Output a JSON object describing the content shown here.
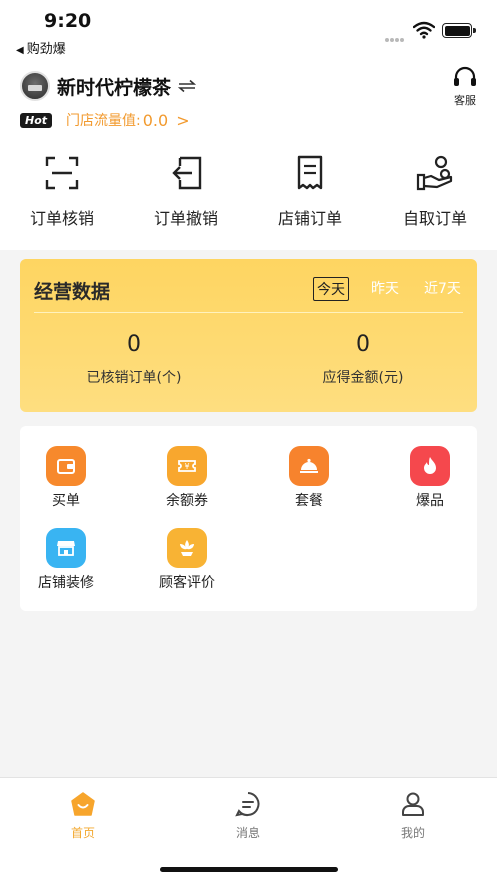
{
  "status_bar": {
    "time": "9:20",
    "back_app": "购劲爆"
  },
  "header": {
    "store_name": "新时代柠檬茶",
    "service_label": "客服",
    "hot_badge": "Hot",
    "traffic_label": "门店流量值:",
    "traffic_value": "0.0",
    "traffic_arrow": ">"
  },
  "quick_actions": [
    {
      "label": "订单核销",
      "icon": "scan-icon"
    },
    {
      "label": "订单撤销",
      "icon": "return-icon"
    },
    {
      "label": "店铺订单",
      "icon": "receipt-icon"
    },
    {
      "label": "自取订单",
      "icon": "hand-pickup-icon"
    }
  ],
  "business": {
    "title": "经营数据",
    "periods": [
      "今天",
      "昨天",
      "近7天"
    ],
    "selected_period": "今天",
    "stats": [
      {
        "value": "0",
        "label": "已核销订单(个)"
      },
      {
        "value": "0",
        "label": "应得金额(元)"
      }
    ]
  },
  "functions": [
    {
      "label": "买单",
      "icon": "wallet-icon",
      "color": "#f7892c"
    },
    {
      "label": "余额券",
      "icon": "coupon-icon",
      "color": "#f8a72e"
    },
    {
      "label": "套餐",
      "icon": "food-cover-icon",
      "color": "#f7832d"
    },
    {
      "label": "爆品",
      "icon": "fire-icon",
      "color": "#f5484d"
    },
    {
      "label": "店铺装修",
      "icon": "storefront-icon",
      "color": "#39b4f2"
    },
    {
      "label": "顾客评价",
      "icon": "flower-icon",
      "color": "#f8b334"
    }
  ],
  "tabbar": {
    "items": [
      {
        "label": "首页",
        "icon": "home-icon",
        "active": true
      },
      {
        "label": "消息",
        "icon": "message-icon",
        "active": false
      },
      {
        "label": "我的",
        "icon": "profile-icon",
        "active": false
      }
    ],
    "accent": "#f3a82f"
  },
  "colors": {
    "card_yellow": "#fed561",
    "traffic_orange": "#f29a2e"
  }
}
